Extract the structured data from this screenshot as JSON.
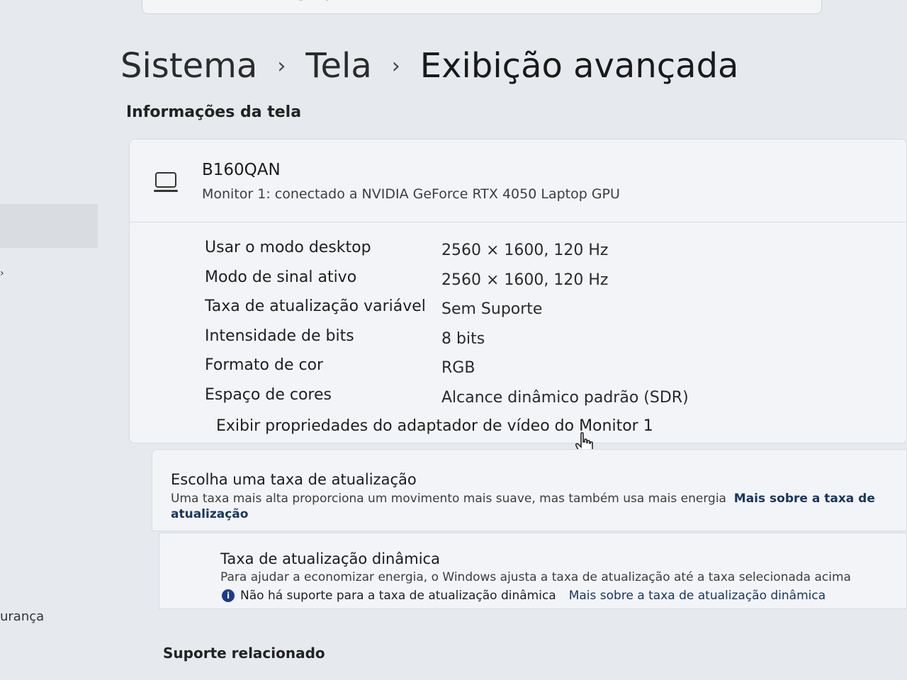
{
  "search": {
    "placeholder": "Localizar uma configuração"
  },
  "sidebar": {
    "partial_label": "urança"
  },
  "breadcrumb": {
    "items": [
      "Sistema",
      "Tela",
      "Exibição avançada"
    ]
  },
  "display_info": {
    "section_title": "Informações da tela",
    "monitor": {
      "name": "B160QAN",
      "description": "Monitor 1: conectado a NVIDIA GeForce RTX 4050 Laptop GPU"
    },
    "properties": [
      {
        "label": "Usar o modo desktop",
        "value": "2560 × 1600, 120 Hz"
      },
      {
        "label": "Modo de sinal ativo",
        "value": "2560 × 1600, 120 Hz"
      },
      {
        "label": "Taxa de atualização variável",
        "value": "Sem Suporte"
      },
      {
        "label": "Intensidade de bits",
        "value": "8 bits"
      },
      {
        "label": "Formato de cor",
        "value": "RGB"
      },
      {
        "label": "Espaço de cores",
        "value": "Alcance dinâmico padrão (SDR)"
      }
    ],
    "adapter_link": "Exibir propriedades do adaptador de vídeo do Monitor 1"
  },
  "refresh_rate": {
    "title": "Escolha uma taxa de atualização",
    "description": "Uma taxa mais alta proporciona um movimento mais suave, mas também usa mais energia",
    "link": "Mais sobre a taxa de atualização"
  },
  "dynamic_refresh": {
    "title": "Taxa de atualização dinâmica",
    "description": "Para ajudar a economizar energia, o Windows ajusta a taxa de atualização até a taxa selecionada acima",
    "note": "Não há suporte para a taxa de atualização dinâmica",
    "link": "Mais sobre a taxa de atualização dinâmica"
  },
  "related": {
    "title": "Suporte relacionado"
  }
}
